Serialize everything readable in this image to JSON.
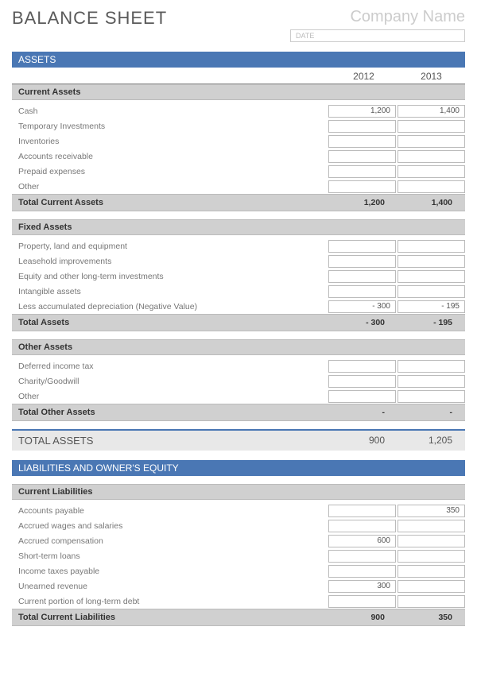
{
  "title": "BALANCE SHEET",
  "company_placeholder": "Company Name",
  "date_placeholder": "DATE",
  "sections": {
    "assets": {
      "header": "ASSETS",
      "years": [
        "2012",
        "2013"
      ],
      "current": {
        "header": "Current Assets",
        "rows": [
          {
            "label": "Cash",
            "v1": "1,200",
            "v2": "1,400"
          },
          {
            "label": "Temporary Investments",
            "v1": "",
            "v2": ""
          },
          {
            "label": "Inventories",
            "v1": "",
            "v2": ""
          },
          {
            "label": "Accounts receivable",
            "v1": "",
            "v2": ""
          },
          {
            "label": "Prepaid expenses",
            "v1": "",
            "v2": ""
          },
          {
            "label": "Other",
            "v1": "",
            "v2": ""
          }
        ],
        "total": {
          "label": "Total Current Assets",
          "v1": "1,200",
          "v2": "1,400"
        }
      },
      "fixed": {
        "header": "Fixed Assets",
        "rows": [
          {
            "label": "Property, land and equipment",
            "v1": "",
            "v2": ""
          },
          {
            "label": "Leasehold improvements",
            "v1": "",
            "v2": ""
          },
          {
            "label": "Equity and other long-term investments",
            "v1": "",
            "v2": ""
          },
          {
            "label": "Intangible assets",
            "v1": "",
            "v2": ""
          },
          {
            "label": "Less accumulated depreciation (Negative Value)",
            "v1": "- 300",
            "v2": "- 195"
          }
        ],
        "total": {
          "label": "Total Assets",
          "v1": "- 300",
          "v2": "- 195"
        }
      },
      "other": {
        "header": "Other Assets",
        "rows": [
          {
            "label": "Deferred income tax",
            "v1": "",
            "v2": ""
          },
          {
            "label": "Charity/Goodwill",
            "v1": "",
            "v2": ""
          },
          {
            "label": "Other",
            "v1": "",
            "v2": ""
          }
        ],
        "total": {
          "label": "Total Other Assets",
          "v1": "-",
          "v2": "-"
        }
      },
      "grand": {
        "label": "TOTAL ASSETS",
        "v1": "900",
        "v2": "1,205"
      }
    },
    "liab": {
      "header": "LIABILITIES AND OWNER'S EQUITY",
      "current": {
        "header": "Current Liabilities",
        "rows": [
          {
            "label": "Accounts payable",
            "v1": "",
            "v2": "350"
          },
          {
            "label": "Accrued wages and salaries",
            "v1": "",
            "v2": ""
          },
          {
            "label": "Accrued compensation",
            "v1": "600",
            "v2": ""
          },
          {
            "label": "Short-term loans",
            "v1": "",
            "v2": ""
          },
          {
            "label": "Income taxes payable",
            "v1": "",
            "v2": ""
          },
          {
            "label": "Unearned revenue",
            "v1": "300",
            "v2": ""
          },
          {
            "label": "Current portion of long-term debt",
            "v1": "",
            "v2": ""
          }
        ],
        "total": {
          "label": "Total Current Liabilities",
          "v1": "900",
          "v2": "350"
        }
      }
    }
  }
}
